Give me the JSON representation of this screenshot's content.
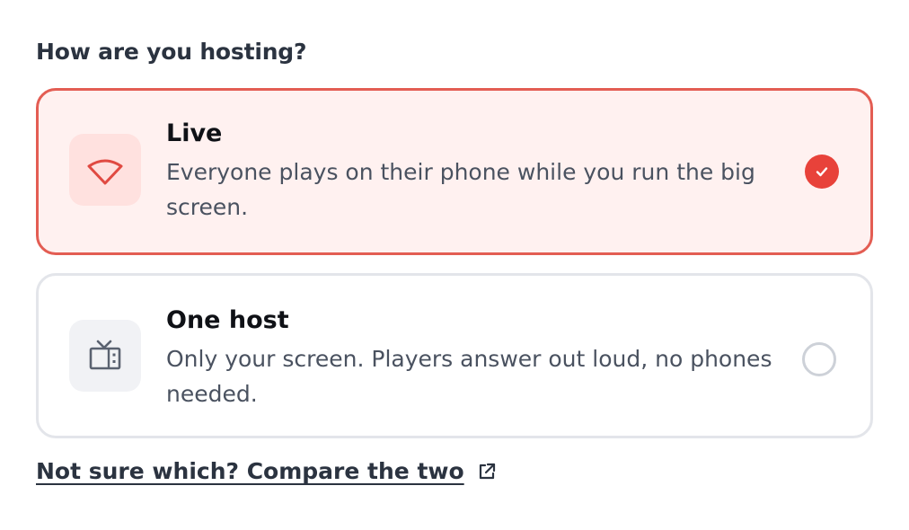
{
  "heading": "How are you hosting?",
  "options": [
    {
      "title": "Live",
      "description": "Everyone plays on their phone while you run the big screen.",
      "icon": "wifi-icon",
      "selected": true
    },
    {
      "title": "One host",
      "description": "Only your screen. Players answer out loud, no phones needed.",
      "icon": "tv-icon",
      "selected": false
    }
  ],
  "compare_link": {
    "label": "Not sure which? Compare the two",
    "icon": "external-link-icon"
  },
  "colors": {
    "accent": "#e8423a",
    "selected_border": "#e35d53",
    "selected_bg": "#fff1f0",
    "selected_tile": "#ffe1df",
    "unselected_border": "#e3e5ea",
    "unselected_tile": "#f1f2f5",
    "heading_text": "#2b3340",
    "body_text": "#4a5260"
  }
}
